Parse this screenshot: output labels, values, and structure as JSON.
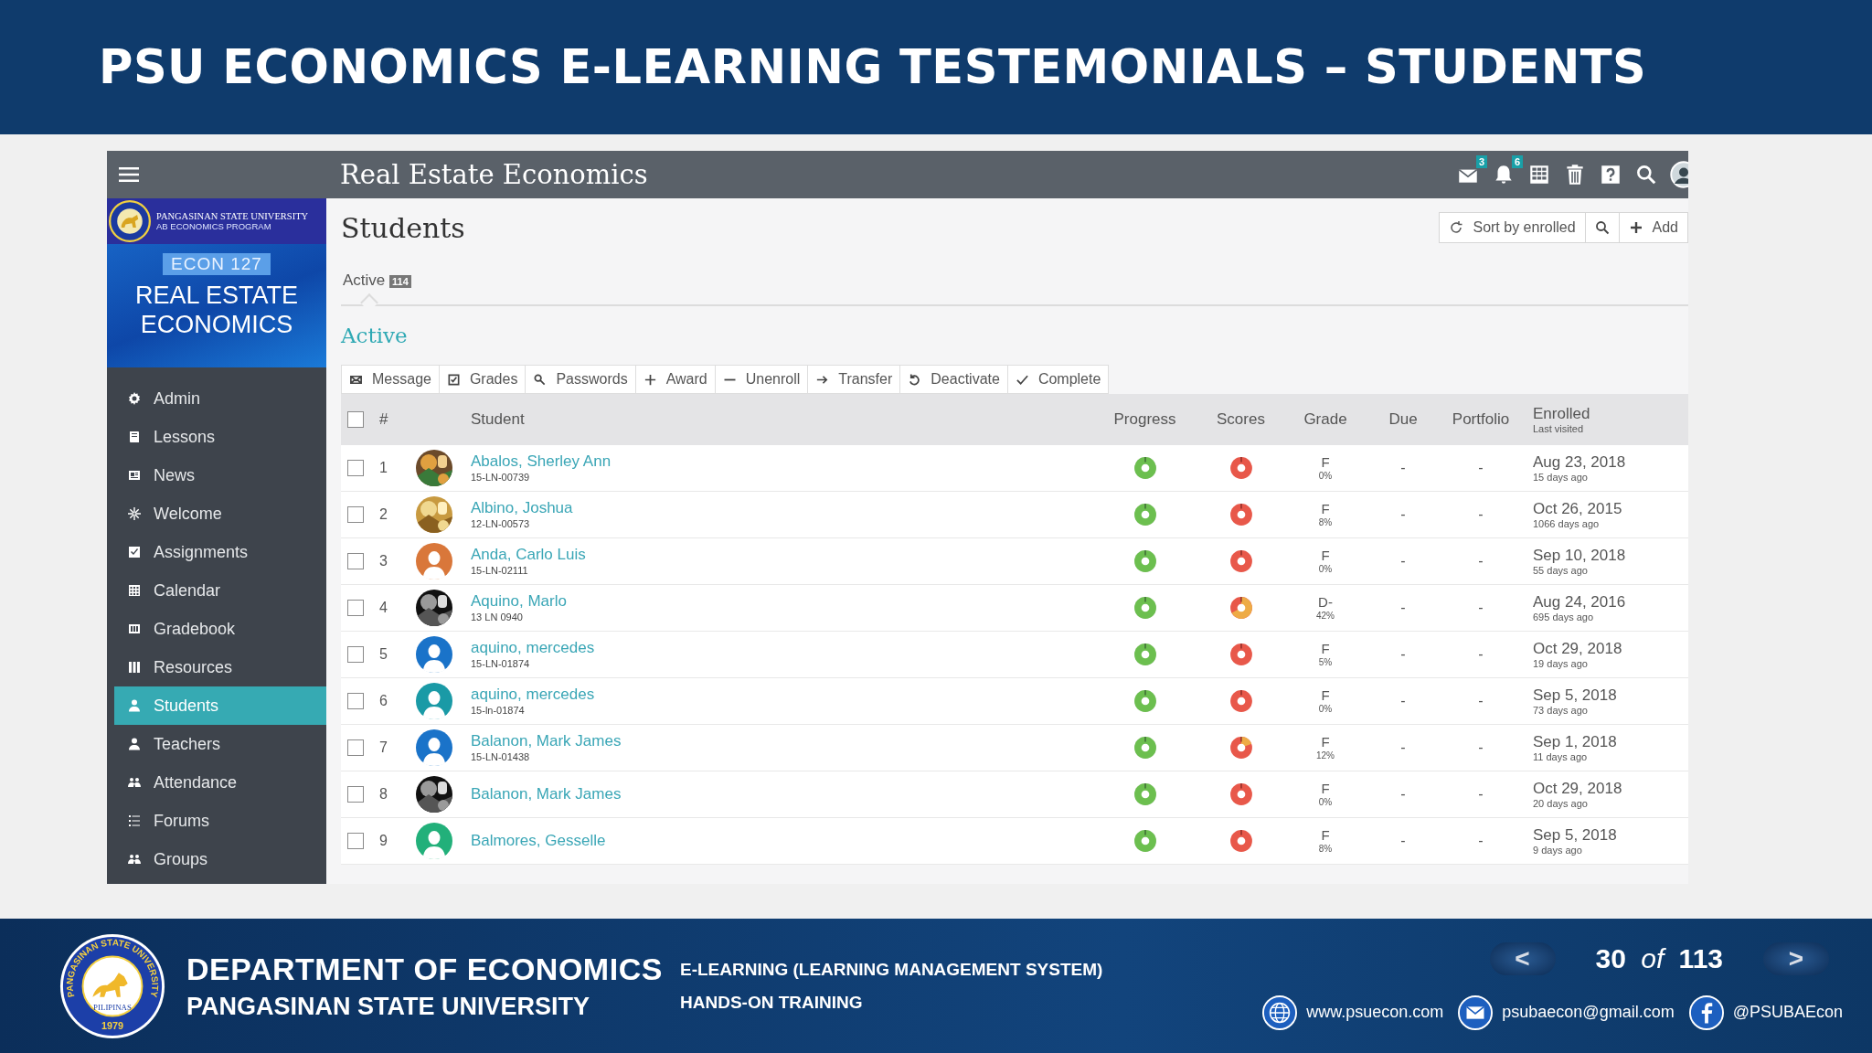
{
  "slide_title": "PSU ECONOMICS E-LEARNING TESTEMONIALS – STUDENTS",
  "app": {
    "course_title": "Real Estate Economics",
    "topbar_icons": [
      {
        "kind": "mail",
        "badge": "3"
      },
      {
        "kind": "bell",
        "badge": "6"
      },
      {
        "kind": "calendar"
      },
      {
        "kind": "trash"
      },
      {
        "kind": "help"
      },
      {
        "kind": "search"
      },
      {
        "kind": "avatar"
      }
    ],
    "banner": {
      "university": "PANGASINAN STATE UNIVERSITY",
      "program": "AB ECONOMICS PROGRAM",
      "code": "ECON 127",
      "course_line1": "REAL ESTATE",
      "course_line2": "ECONOMICS"
    },
    "sidebar": {
      "items": [
        {
          "label": "Admin",
          "kind": "gear",
          "selected": false
        },
        {
          "label": "Lessons",
          "kind": "book",
          "selected": false
        },
        {
          "label": "News",
          "kind": "news",
          "selected": false
        },
        {
          "label": "Welcome",
          "kind": "sparkle",
          "selected": false
        },
        {
          "label": "Assignments",
          "kind": "check",
          "selected": false
        },
        {
          "label": "Calendar",
          "kind": "calendar",
          "selected": false
        },
        {
          "label": "Gradebook",
          "kind": "gradebook",
          "selected": false
        },
        {
          "label": "Resources",
          "kind": "resources",
          "selected": false
        },
        {
          "label": "Students",
          "kind": "person",
          "selected": true
        },
        {
          "label": "Teachers",
          "kind": "person",
          "selected": false
        },
        {
          "label": "Attendance",
          "kind": "group",
          "selected": false
        },
        {
          "label": "Forums",
          "kind": "list",
          "selected": false
        },
        {
          "label": "Groups",
          "kind": "group",
          "selected": false
        }
      ]
    },
    "page_title": "Students",
    "toolbar": [
      {
        "kind": "sort",
        "label": "Sort by enrolled"
      },
      {
        "kind": "search"
      },
      {
        "kind": "add",
        "label": "Add"
      }
    ],
    "tabs": [
      {
        "label": "Active",
        "count": "114",
        "selected": true
      }
    ],
    "section_heading": "Active",
    "actions": [
      {
        "kind": "message",
        "label": "Message"
      },
      {
        "kind": "grades",
        "label": "Grades"
      },
      {
        "kind": "passwords",
        "label": "Passwords"
      },
      {
        "kind": "award",
        "label": "Award"
      },
      {
        "kind": "unenroll",
        "label": "Unenroll"
      },
      {
        "kind": "transfer",
        "label": "Transfer"
      },
      {
        "kind": "deactivate",
        "label": "Deactivate"
      },
      {
        "kind": "complete",
        "label": "Complete"
      }
    ],
    "table": {
      "select_all_checked": false,
      "columns": {
        "number": "#",
        "student": "Student",
        "progress": "Progress",
        "scores": "Scores",
        "grade": "Grade",
        "due": "Due",
        "portfolio": "Portfolio",
        "enrolled": "Enrolled",
        "enrolled_sub": "Last visited"
      },
      "rows": [
        {
          "checked": false,
          "number": "1",
          "name": "Abalos, Sherley Ann",
          "id": "15-LN-00739",
          "grade": "F",
          "grade_pct": "0%",
          "due": "-",
          "portfolio": "-",
          "enrolled": "Aug 23, 2018",
          "last_visited": "15 days ago"
        },
        {
          "checked": false,
          "number": "2",
          "name": "Albino, Joshua",
          "id": "12-LN-00573",
          "grade": "F",
          "grade_pct": "8%",
          "due": "-",
          "portfolio": "-",
          "enrolled": "Oct 26, 2015",
          "last_visited": "1066 days ago"
        },
        {
          "checked": false,
          "number": "3",
          "avatar": {
            "kind": "default",
            "color": "#d9773a"
          },
          "name": "Anda, Carlo Luis",
          "id": "15-LN-02111",
          "grade": "F",
          "grade_pct": "0%",
          "due": "-",
          "portfolio": "-",
          "enrolled": "Sep 10, 2018",
          "last_visited": "55 days ago"
        },
        {
          "checked": false,
          "number": "4",
          "name": "Aquino, Marlo",
          "id": "13 LN 0940",
          "grade": "D-",
          "grade_pct": "42%",
          "due": "-",
          "portfolio": "-",
          "enrolled": "Aug 24, 2016",
          "last_visited": "695 days ago"
        },
        {
          "checked": false,
          "number": "5",
          "avatar": {
            "kind": "default",
            "color": "#1a73c9"
          },
          "name": "aquino, mercedes",
          "id": "15-LN-01874",
          "grade": "F",
          "grade_pct": "5%",
          "due": "-",
          "portfolio": "-",
          "enrolled": "Oct 29, 2018",
          "last_visited": "19 days ago"
        },
        {
          "checked": false,
          "number": "6",
          "avatar": {
            "kind": "default",
            "color": "#1a9aa6"
          },
          "name": "aquino, mercedes",
          "id": "15-ln-01874",
          "grade": "F",
          "grade_pct": "0%",
          "due": "-",
          "portfolio": "-",
          "enrolled": "Sep 5, 2018",
          "last_visited": "73 days ago"
        },
        {
          "checked": false,
          "number": "7",
          "avatar": {
            "kind": "default",
            "color": "#1a73c9"
          },
          "name": "Balanon, Mark James",
          "id": "15-LN-01438",
          "grade": "F",
          "grade_pct": "12%",
          "due": "-",
          "portfolio": "-",
          "enrolled": "Sep 1, 2018",
          "last_visited": "11 days ago"
        },
        {
          "checked": false,
          "number": "8",
          "name": "Balanon, Mark James",
          "grade": "F",
          "grade_pct": "0%",
          "due": "-",
          "portfolio": "-",
          "enrolled": "Oct 29, 2018",
          "last_visited": "20 days ago"
        },
        {
          "checked": false,
          "number": "9",
          "avatar": {
            "kind": "default",
            "color": "#22b07a"
          },
          "name": "Balmores, Gesselle",
          "grade": "F",
          "grade_pct": "8%",
          "due": "-",
          "portfolio": "-",
          "enrolled": "Sep 5, 2018",
          "last_visited": "9 days ago"
        }
      ]
    }
  },
  "footer": {
    "seal": {
      "ring": "PANGASINAN STATE UNIVERSITY",
      "motto": "PILIPINAS",
      "year": "1979"
    },
    "department": "DEPARTMENT OF ECONOMICS",
    "university": "PANGASINAN STATE UNIVERSITY",
    "course_line1": "E-LEARNING (LEARNING MANAGEMENT SYSTEM)",
    "course_line2": "HANDS-ON TRAINING",
    "nav": {
      "prev": "<",
      "current": "30",
      "of": "of",
      "total": "113",
      "next": ">"
    },
    "contacts": [
      {
        "kind": "web",
        "text": "www.psuecon.com"
      },
      {
        "kind": "email",
        "text": "psubaecon@gmail.com"
      },
      {
        "kind": "facebook",
        "text": "@PSUBAEcon"
      }
    ]
  }
}
